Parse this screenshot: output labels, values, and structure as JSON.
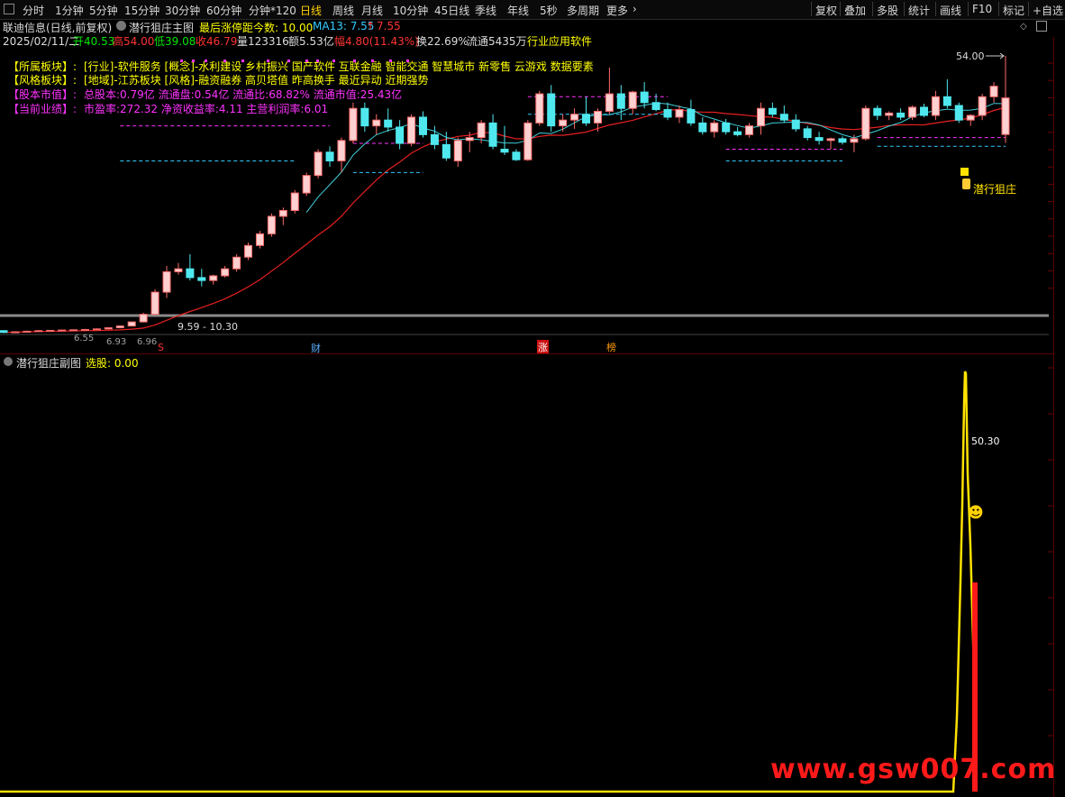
{
  "toolbar": {
    "left": [
      "分时",
      "1分钟",
      "5分钟",
      "15分钟",
      "30分钟",
      "60分钟",
      "分钟*120",
      "日线",
      "周线",
      "月线",
      "10分钟",
      "45日线",
      "季线",
      "年线",
      "5秒",
      "多周期",
      "更多"
    ],
    "active": "日线",
    "right": [
      "复权",
      "叠加",
      "多股",
      "统计",
      "画线",
      "F10",
      "标记",
      "+自选"
    ]
  },
  "header": {
    "stock_name": "联迪信息(日线,前复权)",
    "indicator_name": "潜行狙庄主图",
    "limit_text": "最后涨停距今数: 10.00",
    "ma_label": "MA13: 7.55",
    "ma_arrow": "↑",
    "ma_value": "7.55"
  },
  "quote": {
    "date": "2025/02/11/二",
    "open": "开40.53",
    "high": "高54.00",
    "low": "低39.08",
    "close": "收46.79",
    "volume": "量123316",
    "amount": "额5.53亿",
    "change": "幅4.80(11.43%)",
    "turnover": "换22.69%",
    "float": "流通5435万",
    "industry": "行业应用软件"
  },
  "info": [
    {
      "label": "【所属板块】:",
      "value": "[行业]-软件服务 [概念]-水利建设 乡村振兴 国产软件 互联金融 智能交通 智慧城市 新零售 云游戏 数据要素"
    },
    {
      "label": "【风格板块】:",
      "value": "[地域]-江苏板块 [风格]-融资融券 高贝塔值 昨高换手 最近异动 近期强势"
    },
    {
      "label": "【股本市值】:",
      "value": "总股本:0.79亿 流通盘:0.54亿 流通比:68.82% 流通市值:25.43亿"
    },
    {
      "label": "【当前业绩】:",
      "value": "市盈率:272.32 净资收益率:4.11 主营利润率:6.01"
    }
  ],
  "main_chart": {
    "high_label": "54.00",
    "range_label": "9.59 - 10.30",
    "low_label_1": "6.55",
    "low_label_2": "6.93",
    "low_label_3": "6.96",
    "signal_label": "潜行狙庄",
    "markers": [
      "S",
      "财",
      "涨",
      "榜"
    ]
  },
  "sub_chart": {
    "title": "潜行狙庄副图",
    "select_label": "选股: 0.00",
    "peak_value": "50.30",
    "smiley": "☻"
  },
  "watermark": "www.gsw007.com",
  "colors": {
    "up": "#ff6b6b",
    "up_fill": "#ffd0d0",
    "down": "#4fe8ee",
    "ma": "#e62020",
    "ma2": "#3fd0d8",
    "dash_m": "#ff33ff",
    "dash_c": "#33ccff",
    "signal": "#ffe100"
  },
  "chart_data": {
    "type": "candlestick",
    "title": "",
    "xlabel": "",
    "ylabel": "",
    "ohlc": [
      [
        6.9,
        7.0,
        6.5,
        6.6
      ],
      [
        6.6,
        6.8,
        6.5,
        6.7
      ],
      [
        6.7,
        6.9,
        6.6,
        6.8
      ],
      [
        6.8,
        7.0,
        6.7,
        6.9
      ],
      [
        6.9,
        7.0,
        6.8,
        6.95
      ],
      [
        6.95,
        7.1,
        6.9,
        7.0
      ],
      [
        7.0,
        7.1,
        6.9,
        7.05
      ],
      [
        7.05,
        7.2,
        7.0,
        7.1
      ],
      [
        7.1,
        7.3,
        7.0,
        7.2
      ],
      [
        7.2,
        7.5,
        7.1,
        7.4
      ],
      [
        7.4,
        7.8,
        7.3,
        7.7
      ],
      [
        7.7,
        8.5,
        7.6,
        8.4
      ],
      [
        8.4,
        10.0,
        8.3,
        9.7
      ],
      [
        9.7,
        14.0,
        9.6,
        13.5
      ],
      [
        13.5,
        18.0,
        12.5,
        17.0
      ],
      [
        17.0,
        18.5,
        16.5,
        17.5
      ],
      [
        17.5,
        20.0,
        15.5,
        16.0
      ],
      [
        16.0,
        17.5,
        14.5,
        15.5
      ],
      [
        15.5,
        16.5,
        14.8,
        16.3
      ],
      [
        16.3,
        18.0,
        16.0,
        17.5
      ],
      [
        17.5,
        20.0,
        17.0,
        19.5
      ],
      [
        19.5,
        22.0,
        19.0,
        21.5
      ],
      [
        21.5,
        24.0,
        21.0,
        23.5
      ],
      [
        23.5,
        27.0,
        23.0,
        26.5
      ],
      [
        26.5,
        28.0,
        25.0,
        27.5
      ],
      [
        27.5,
        31.0,
        27.0,
        30.5
      ],
      [
        30.5,
        34.0,
        30.0,
        33.5
      ],
      [
        33.5,
        38.0,
        33.0,
        37.5
      ],
      [
        37.5,
        38.5,
        35.0,
        36.0
      ],
      [
        36.0,
        40.0,
        34.0,
        39.5
      ],
      [
        39.5,
        46.0,
        39.0,
        45.0
      ],
      [
        45.0,
        46.0,
        41.0,
        42.0
      ],
      [
        42.0,
        44.0,
        40.5,
        43.0
      ],
      [
        43.0,
        45.0,
        41.0,
        41.8
      ],
      [
        41.8,
        43.0,
        38.0,
        39.0
      ],
      [
        39.0,
        44.0,
        38.5,
        43.5
      ],
      [
        43.5,
        44.5,
        40.0,
        40.5
      ],
      [
        40.5,
        42.0,
        38.0,
        38.8
      ],
      [
        38.8,
        41.0,
        36.0,
        36.5
      ],
      [
        36.0,
        40.0,
        35.0,
        39.5
      ],
      [
        39.5,
        41.0,
        37.5,
        40.0
      ],
      [
        40.0,
        43.0,
        39.0,
        42.5
      ],
      [
        42.5,
        44.0,
        38.0,
        38.5
      ],
      [
        38.0,
        42.0,
        37.0,
        37.5
      ],
      [
        37.5,
        38.0,
        36.0,
        36.2
      ],
      [
        36.2,
        43.0,
        36.0,
        42.5
      ],
      [
        42.5,
        48.0,
        42.0,
        47.5
      ],
      [
        47.5,
        49.0,
        41.0,
        42.0
      ],
      [
        42.0,
        44.0,
        41.0,
        43.0
      ],
      [
        43.0,
        45.0,
        41.5,
        44.0
      ],
      [
        44.0,
        47.0,
        42.0,
        42.5
      ],
      [
        42.5,
        45.0,
        41.0,
        44.5
      ],
      [
        44.5,
        52.0,
        44.0,
        47.5
      ],
      [
        47.5,
        49.0,
        43.0,
        45.0
      ],
      [
        45.0,
        48.0,
        44.0,
        47.8
      ],
      [
        47.8,
        49.5,
        45.0,
        46.0
      ],
      [
        46.0,
        47.5,
        44.5,
        44.8
      ],
      [
        44.8,
        46.0,
        43.0,
        43.5
      ],
      [
        43.5,
        45.5,
        42.5,
        44.8
      ],
      [
        44.8,
        46.5,
        42.0,
        42.5
      ],
      [
        42.5,
        43.5,
        40.5,
        41.0
      ],
      [
        41.0,
        43.0,
        40.0,
        42.5
      ],
      [
        42.5,
        43.2,
        40.5,
        41.0
      ],
      [
        41.0,
        41.8,
        40.2,
        40.5
      ],
      [
        40.5,
        42.5,
        40.0,
        42.0
      ],
      [
        42.0,
        46.0,
        40.5,
        45.0
      ],
      [
        45.0,
        46.0,
        43.5,
        44.0
      ],
      [
        44.0,
        45.5,
        42.5,
        43.0
      ],
      [
        43.0,
        44.0,
        41.0,
        41.5
      ],
      [
        41.5,
        42.0,
        39.5,
        40.0
      ],
      [
        40.0,
        41.0,
        38.8,
        39.5
      ],
      [
        39.5,
        40.0,
        38.0,
        39.8
      ],
      [
        39.8,
        40.2,
        38.8,
        39.2
      ],
      [
        39.2,
        40.5,
        37.5,
        39.8
      ],
      [
        39.8,
        45.5,
        39.5,
        45.0
      ],
      [
        45.0,
        45.5,
        43.0,
        43.8
      ],
      [
        43.8,
        44.5,
        43.0,
        44.2
      ],
      [
        44.2,
        45.0,
        43.0,
        43.5
      ],
      [
        43.5,
        45.5,
        43.0,
        45.2
      ],
      [
        45.2,
        45.8,
        43.5,
        43.8
      ],
      [
        43.8,
        48.0,
        43.0,
        47.0
      ],
      [
        47.0,
        50.0,
        45.0,
        45.5
      ],
      [
        45.5,
        46.0,
        42.5,
        43.0
      ],
      [
        43.0,
        44.0,
        42.0,
        43.8
      ],
      [
        43.8,
        47.5,
        43.0,
        47.0
      ],
      [
        47.0,
        49.5,
        46.0,
        48.8
      ],
      [
        40.53,
        54.0,
        39.08,
        46.79
      ]
    ]
  }
}
